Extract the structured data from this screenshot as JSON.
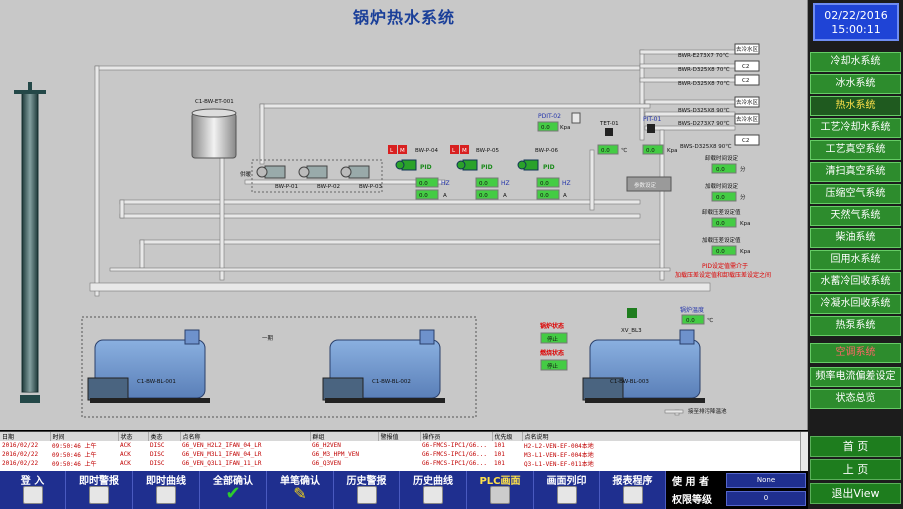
{
  "title": "锅炉热水系统",
  "clock": {
    "date": "02/22/2016",
    "time": "15:00:11"
  },
  "menu": [
    {
      "label": "冷却水系统",
      "state": "normal"
    },
    {
      "label": "冰水系统",
      "state": "normal"
    },
    {
      "label": "热水系统",
      "state": "active"
    },
    {
      "label": "工艺冷却水系统",
      "state": "normal"
    },
    {
      "label": "工艺真空系统",
      "state": "normal"
    },
    {
      "label": "清扫真空系统",
      "state": "normal"
    },
    {
      "label": "压缩空气系统",
      "state": "normal"
    },
    {
      "label": "天然气系统",
      "state": "normal"
    },
    {
      "label": "柴油系统",
      "state": "normal"
    },
    {
      "label": "回用水系统",
      "state": "normal"
    },
    {
      "label": "水蓄冷回收系统",
      "state": "normal"
    },
    {
      "label": "冷凝水回收系统",
      "state": "normal"
    },
    {
      "label": "热泵系统",
      "state": "normal"
    },
    {
      "label": "空调系统",
      "state": "warn"
    },
    {
      "label": "频率电流偏差设定",
      "state": "normal"
    },
    {
      "label": "状态总览",
      "state": "normal"
    }
  ],
  "nav": {
    "home": "首 页",
    "prev": "上 页",
    "exit": "退出View"
  },
  "diagram": {
    "tank_label": "C1-BW-ET-001",
    "pump_group_label": "供暖",
    "pumps_supply": [
      "BW-P-01",
      "BW-P-02",
      "BW-P-03"
    ],
    "pumps_main": [
      {
        "name": "BW-P-04",
        "hz": "0.0",
        "a": "0.0"
      },
      {
        "name": "BW-P-05",
        "hz": "0.0",
        "a": "0.0"
      },
      {
        "name": "BW-P-06",
        "hz": "0.0",
        "a": "0.0"
      }
    ],
    "run_labels": {
      "l": "L",
      "m": "M",
      "pid": "PID",
      "hz_unit": "HZ",
      "a_unit": "A"
    },
    "pipes_out": [
      {
        "label": "BWR-E273X7 70℃",
        "tag": "去冷水区"
      },
      {
        "label": "BWR-D325X8 70℃",
        "tag": "C2"
      },
      {
        "label": "BWR-D325X8 70℃",
        "tag": "C2"
      },
      {
        "label": "BWS-D325X8 90℃",
        "tag": "去冷水区"
      },
      {
        "label": "BWS-D273X7 90℃",
        "tag": "去冷水区"
      },
      {
        "label": "BWS-D325X8 90℃",
        "tag": "C2"
      }
    ],
    "instruments": {
      "pdit": {
        "name": "PDIT-02",
        "value": "0.0",
        "unit": "Kpa"
      },
      "tet": {
        "name": "TET-01",
        "value": "0.0",
        "unit": "℃"
      },
      "pit": {
        "name": "PIT-01",
        "value": "0.0",
        "unit": "Kpa"
      }
    },
    "param_button": "参数设定",
    "settings": [
      {
        "label": "卸载时间设定",
        "value": "0.0",
        "unit": "分"
      },
      {
        "label": "加载时间设定",
        "value": "0.0",
        "unit": "分"
      },
      {
        "label": "卸载压差设定值",
        "value": "0.0",
        "unit": "Kpa"
      },
      {
        "label": "加载压差设定值",
        "value": "0.0",
        "unit": "Kpa"
      }
    ],
    "pid_note_1": "PID设定值需介于",
    "pid_note_2": "加载压差设定值和卸载压差设定之间",
    "area_label": "一期",
    "boilers": [
      "C1-BW-BL-001",
      "C1-BW-BL-002",
      "C1-BW-BL-003"
    ],
    "boiler_status": {
      "status_label": "锅炉状态",
      "fault_label": "燃烧状态",
      "stop_label": "停止",
      "s1": "停止",
      "s2": "停止"
    },
    "boiler_temp": {
      "label": "锅炉温度",
      "value": "0.0",
      "unit": "℃"
    },
    "valve_label": "XV_BL3",
    "drain_label": "接至排污降温池"
  },
  "alarm": {
    "headers": [
      "日期",
      "时间",
      "状态",
      "类态",
      "点名称",
      "群组",
      "警报值",
      "操作员",
      "优先级",
      "点名说明"
    ],
    "rows": [
      [
        "2016/02/22",
        "09:50:46 上午",
        "ACK",
        "DISC",
        "G6_VEN_H2L2_IFAN_04_LR",
        "G6_H2VEN",
        "",
        "G6-FMCS-IPC1/G6...",
        "101",
        "H2-L2-VEN-EF-004本地"
      ],
      [
        "2016/02/22",
        "09:50:46 上午",
        "ACK",
        "DISC",
        "G6_VEN_M3L1_IFAN_04_LR",
        "G6_M3_HPM_VEN",
        "",
        "G6-FMCS-IPC1/G6...",
        "101",
        "M3-L1-VEN-EF-004本地"
      ],
      [
        "2016/02/22",
        "09:50:46 上午",
        "ACK",
        "DISC",
        "G6_VEN_Q3L1_IFAN_11_LR",
        "G6_Q3VEN",
        "",
        "G6-FMCS-IPC1/G6...",
        "101",
        "Q3-L1-VEN-EF-011本地"
      ]
    ]
  },
  "toolbar": [
    {
      "label": "登 入",
      "name": "login"
    },
    {
      "label": "即时警报",
      "name": "realtime-alarm"
    },
    {
      "label": "即时曲线",
      "name": "realtime-curve"
    },
    {
      "label": "全部确认",
      "name": "ack-all"
    },
    {
      "label": "单笔确认",
      "name": "ack-single"
    },
    {
      "label": "历史警报",
      "name": "history-alarm"
    },
    {
      "label": "历史曲线",
      "name": "history-curve"
    },
    {
      "label": "PLC画面",
      "name": "plc-screen"
    },
    {
      "label": "画面列印",
      "name": "print-screen"
    },
    {
      "label": "报表程序",
      "name": "report-program"
    }
  ],
  "user": {
    "user_label": "使 用 者",
    "user_value": "None",
    "level_label": "权限等级",
    "level_value": "0"
  },
  "colors": {
    "accent_green": "#2d8c2d",
    "toolbar_blue": "#1f2f8f",
    "alarm_red": "#c00000",
    "title_blue": "#1a3f99"
  }
}
